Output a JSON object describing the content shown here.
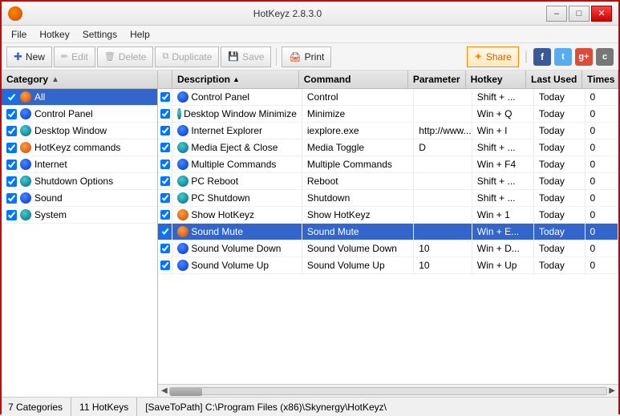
{
  "app": {
    "title": "HotKeyz 2.8.3.0",
    "icon": "flame-icon"
  },
  "window_controls": {
    "minimize": "–",
    "maximize": "□",
    "close": "✕"
  },
  "menu": {
    "items": [
      "File",
      "Hotkey",
      "Settings",
      "Help"
    ]
  },
  "toolbar": {
    "new_label": "New",
    "edit_label": "Edit",
    "delete_label": "Delete",
    "duplicate_label": "Duplicate",
    "save_label": "Save",
    "print_label": "Print",
    "share_label": "Share"
  },
  "left_panel": {
    "header": "Category",
    "items": [
      {
        "id": "all",
        "label": "All",
        "color": "orange",
        "checked": true
      },
      {
        "id": "control-panel",
        "label": "Control Panel",
        "color": "blue",
        "checked": true
      },
      {
        "id": "desktop-window",
        "label": "Desktop Window",
        "color": "teal",
        "checked": true
      },
      {
        "id": "hotkeyz-commands",
        "label": "HotKeyz commands",
        "color": "orange",
        "checked": true
      },
      {
        "id": "internet",
        "label": "Internet",
        "color": "blue",
        "checked": true
      },
      {
        "id": "shutdown-options",
        "label": "Shutdown Options",
        "color": "teal",
        "checked": true
      },
      {
        "id": "sound",
        "label": "Sound",
        "color": "blue",
        "checked": true
      },
      {
        "id": "system",
        "label": "System",
        "color": "teal",
        "checked": true
      }
    ]
  },
  "table": {
    "columns": [
      {
        "id": "description",
        "label": "Description",
        "sort": "asc"
      },
      {
        "id": "command",
        "label": "Command"
      },
      {
        "id": "parameter",
        "label": "Parameter"
      },
      {
        "id": "hotkey",
        "label": "Hotkey"
      },
      {
        "id": "last_used",
        "label": "Last Used"
      },
      {
        "id": "times",
        "label": "Times"
      }
    ],
    "rows": [
      {
        "description": "Control Panel",
        "command": "Control",
        "parameter": "",
        "hotkey": "Shift + ...",
        "last_used": "Today",
        "times": "0",
        "icon": "blue",
        "checked": true
      },
      {
        "description": "Desktop Window Minimize",
        "command": "Minimize",
        "parameter": "",
        "hotkey": "Win + Q",
        "last_used": "Today",
        "times": "0",
        "icon": "teal",
        "checked": true
      },
      {
        "description": "Internet Explorer",
        "command": "iexplore.exe",
        "parameter": "http://www...",
        "hotkey": "Win + I",
        "last_used": "Today",
        "times": "0",
        "icon": "blue",
        "checked": true
      },
      {
        "description": "Media Eject & Close",
        "command": "Media Toggle",
        "parameter": "D",
        "hotkey": "Shift + ...",
        "last_used": "Today",
        "times": "0",
        "icon": "teal",
        "checked": true
      },
      {
        "description": "Multiple Commands",
        "command": "Multiple Commands",
        "parameter": "",
        "hotkey": "Win + F4",
        "last_used": "Today",
        "times": "0",
        "icon": "blue",
        "checked": true
      },
      {
        "description": "PC Reboot",
        "command": "Reboot",
        "parameter": "",
        "hotkey": "Shift + ...",
        "last_used": "Today",
        "times": "0",
        "icon": "teal",
        "checked": true
      },
      {
        "description": "PC Shutdown",
        "command": "Shutdown",
        "parameter": "",
        "hotkey": "Shift + ...",
        "last_used": "Today",
        "times": "0",
        "icon": "teal",
        "checked": true
      },
      {
        "description": "Show HotKeyz",
        "command": "Show HotKeyz",
        "parameter": "",
        "hotkey": "Win + 1",
        "last_used": "Today",
        "times": "0",
        "icon": "orange",
        "checked": true
      },
      {
        "description": "Sound Mute",
        "command": "Sound Mute",
        "parameter": "",
        "hotkey": "Win + E...",
        "last_used": "Today",
        "times": "0",
        "icon": "orange",
        "checked": true
      },
      {
        "description": "Sound Volume Down",
        "command": "Sound Volume Down",
        "parameter": "10",
        "hotkey": "Win + D...",
        "last_used": "Today",
        "times": "0",
        "icon": "blue",
        "checked": true
      },
      {
        "description": "Sound Volume Up",
        "command": "Sound Volume Up",
        "parameter": "10",
        "hotkey": "Win + Up",
        "last_used": "Today",
        "times": "0",
        "icon": "blue",
        "checked": true
      }
    ]
  },
  "status_bar": {
    "categories": "7 Categories",
    "hotkeys": "11 HotKeys",
    "path": "[SaveToPath] C:\\Program Files (x86)\\Skynergy\\HotKeyz\\"
  }
}
